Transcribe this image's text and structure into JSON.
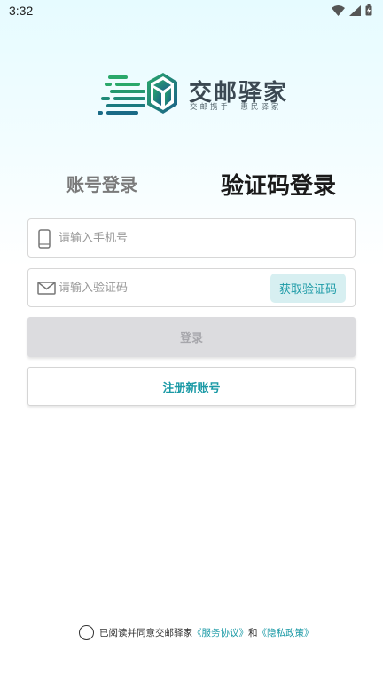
{
  "status_bar": {
    "time": "3:32"
  },
  "logo": {
    "title": "交邮驿家",
    "subtitle": "交邮携手  惠民驿家"
  },
  "tabs": [
    {
      "label": "账号登录",
      "active": false
    },
    {
      "label": "验证码登录",
      "active": true
    }
  ],
  "form": {
    "phone": {
      "value": "",
      "placeholder": "请输入手机号"
    },
    "code": {
      "value": "",
      "placeholder": "请输入验证码"
    },
    "get_code_label": "获取验证码",
    "login_label": "登录",
    "register_label": "注册新账号"
  },
  "agreement": {
    "prefix": "已阅读并同意交邮驿家",
    "service_link": "《服务协议》",
    "and": "和",
    "privacy_link": "《隐私政策》",
    "checked": false
  },
  "colors": {
    "accent": "#1b9aa6",
    "logo_green": "#2aa86a",
    "logo_blue": "#1a5f8a"
  }
}
